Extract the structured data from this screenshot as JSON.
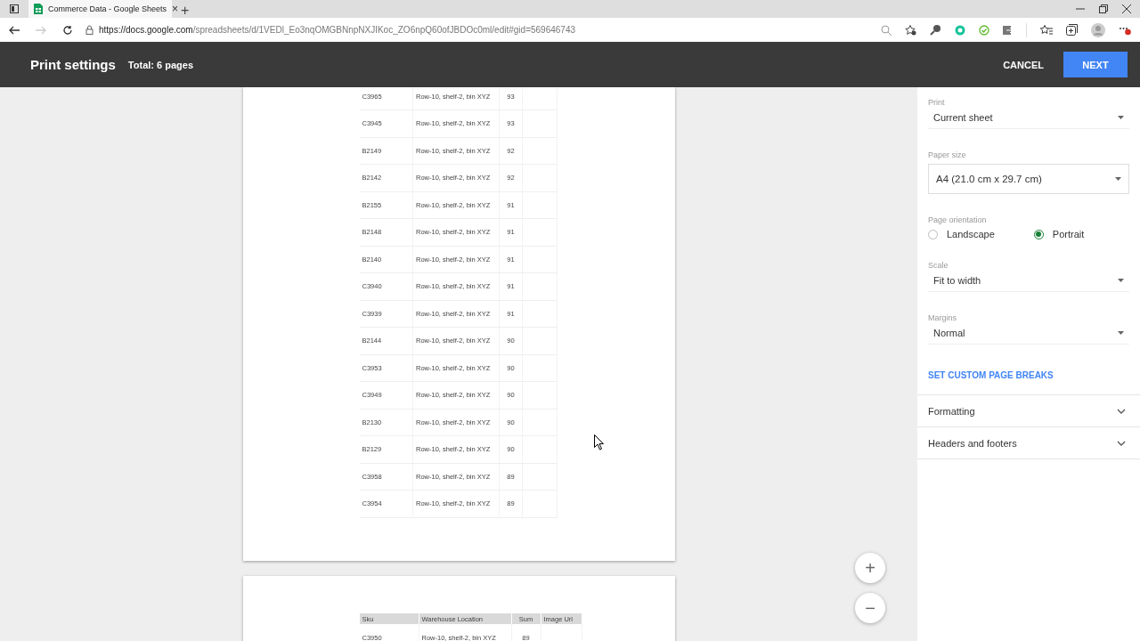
{
  "browser": {
    "tab_title": "Commerce Data - Google Sheets",
    "tab_close": "×",
    "new_tab": "+",
    "url_host": "https://docs.google.com",
    "url_path": "/spreadsheets/d/1VEDl_Eo3nqOMGBNnpNXJIKoc_ZO6npQ60ofJBDOc0ml/edit#gid=569646743"
  },
  "header": {
    "title": "Print settings",
    "total": "Total: 6 pages",
    "cancel": "CANCEL",
    "next": "NEXT"
  },
  "preview": {
    "pages": [
      {
        "rows": [
          [
            "C3965",
            "Row-10, shelf-2, bin XYZ",
            "93"
          ],
          [
            "C3945",
            "Row-10, shelf-2, bin XYZ",
            "93"
          ],
          [
            "B2149",
            "Row-10, shelf-2, bin XYZ",
            "92"
          ],
          [
            "B2142",
            "Row-10, shelf-2, bin XYZ",
            "92"
          ],
          [
            "B2155",
            "Row-10, shelf-2, bin XYZ",
            "91"
          ],
          [
            "B2148",
            "Row-10, shelf-2, bin XYZ",
            "91"
          ],
          [
            "B2140",
            "Row-10, shelf-2, bin XYZ",
            "91"
          ],
          [
            "C3940",
            "Row-10, shelf-2, bin XYZ",
            "91"
          ],
          [
            "C3939",
            "Row-10, shelf-2, bin XYZ",
            "91"
          ],
          [
            "B2144",
            "Row-10, shelf-2, bin XYZ",
            "90"
          ],
          [
            "C3953",
            "Row-10, shelf-2, bin XYZ",
            "90"
          ],
          [
            "C3949",
            "Row-10, shelf-2, bin XYZ",
            "90"
          ],
          [
            "B2130",
            "Row-10, shelf-2, bin XYZ",
            "90"
          ],
          [
            "B2129",
            "Row-10, shelf-2, bin XYZ",
            "90"
          ],
          [
            "C3958",
            "Row-10, shelf-2, bin XYZ",
            "89"
          ],
          [
            "C3954",
            "Row-10, shelf-2, bin XYZ",
            "89"
          ]
        ]
      },
      {
        "columns": [
          "Sku",
          "Warehouse Location",
          "Sum",
          "Image Url"
        ],
        "rows": [
          [
            "C3950",
            "Row-10, shelf-2, bin XYZ",
            "89"
          ]
        ]
      }
    ],
    "zoom_in": "+",
    "zoom_out": "−"
  },
  "settings": [
    {
      "kind": "dropdown",
      "label": "Print",
      "value": "Current sheet"
    },
    {
      "kind": "boxed",
      "label": "Paper size",
      "value": "A4 (21.0 cm x 29.7 cm)"
    },
    {
      "kind": "radio",
      "label": "Page orientation",
      "options": [
        {
          "label": "Landscape",
          "selected": false
        },
        {
          "label": "Portrait",
          "selected": true
        }
      ]
    },
    {
      "kind": "dropdown",
      "label": "Scale",
      "value": "Fit to width"
    },
    {
      "kind": "dropdown",
      "label": "Margins",
      "value": "Normal"
    },
    {
      "kind": "link",
      "value": "SET CUSTOM PAGE BREAKS"
    },
    {
      "kind": "section",
      "value": "Formatting",
      "expanded": false
    },
    {
      "kind": "section",
      "value": "Headers and footers",
      "expanded": false
    }
  ]
}
